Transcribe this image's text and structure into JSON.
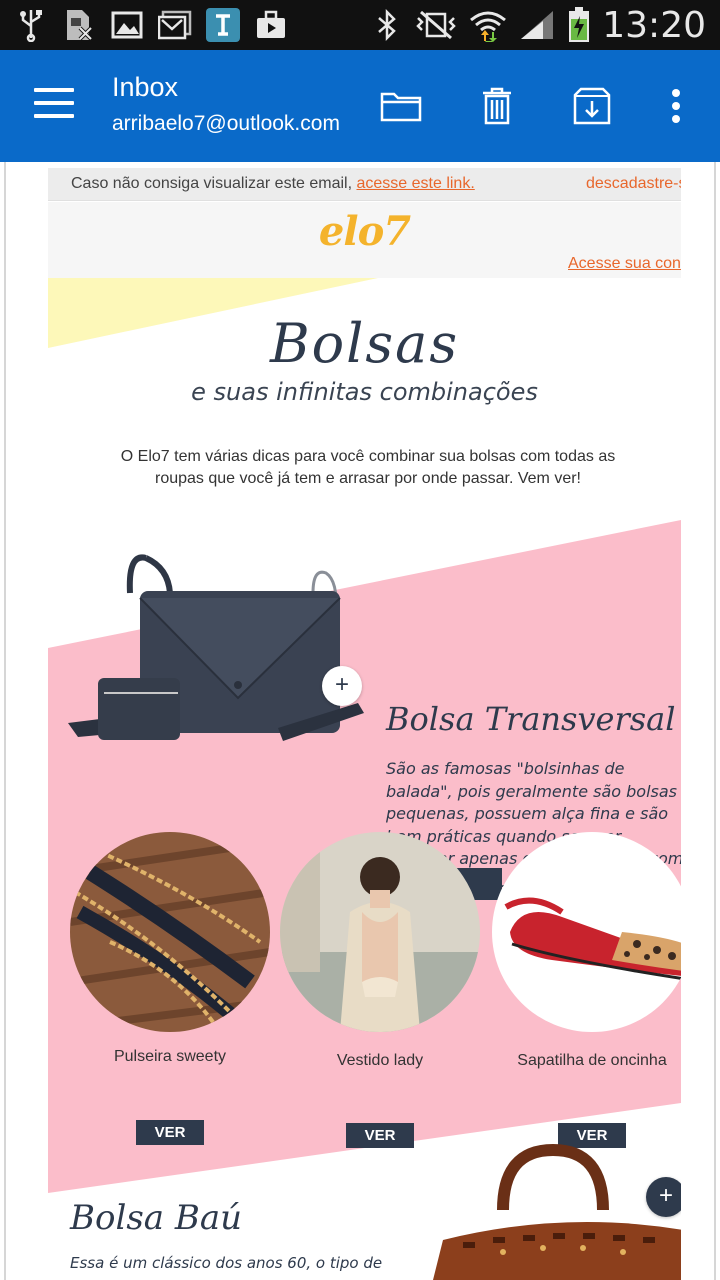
{
  "status_bar": {
    "time": "13:20",
    "left_icons": [
      "usb-icon",
      "sim-missing-icon",
      "image-icon",
      "email-icon",
      "app-icon",
      "briefcase-icon"
    ],
    "right_icons": [
      "bluetooth-icon",
      "vibrate-icon",
      "wifi-icon",
      "signal-icon",
      "battery-charging-icon"
    ]
  },
  "app_bar": {
    "title": "Inbox",
    "account": "arribaelo7@outlook.com",
    "actions": [
      "folder-icon",
      "trash-icon",
      "archive-icon",
      "more-vert-icon"
    ],
    "color": "#0a6ac9"
  },
  "email": {
    "preheader": {
      "text": "Caso não consiga visualizar este email, ",
      "link": "acesse este link.",
      "unsubscribe": "descadastre-s"
    },
    "logo": "elo7",
    "account_link": "Acesse sua con",
    "hero": {
      "title": "Bolsas",
      "subtitle": "e suas infinitas combinações",
      "description": "O Elo7 tem várias dicas para você combinar sua bolsas com todas as roupas que você já tem e arrasar por onde passar. Vem ver!"
    },
    "feature": {
      "title": "Bolsa Transversal",
      "description": "São as famosas \"bolsinhas de balada\", pois geralmente são bolsas pequenas, possuem alça fina e são bem práticas quando se quer carregar apenas o básico e ficar com as mãos livres.",
      "button": "VER",
      "plus": "+"
    },
    "items": [
      {
        "label": "Pulseira sweety",
        "button": "VER"
      },
      {
        "label": "Vestido lady",
        "button": "VER"
      },
      {
        "label": "Sapatilha de oncinha",
        "button": "VER"
      }
    ],
    "next_section": {
      "title": "Bolsa Baú",
      "description": "Essa é um clássico dos anos 60, o tipo de",
      "plus": "+"
    },
    "colors": {
      "pink": "#fbbdca",
      "navy": "#2e3a4c",
      "orange_link": "#e8672c",
      "logo_yellow": "#f4b32c",
      "pale_yellow": "#fdf8b9"
    }
  }
}
